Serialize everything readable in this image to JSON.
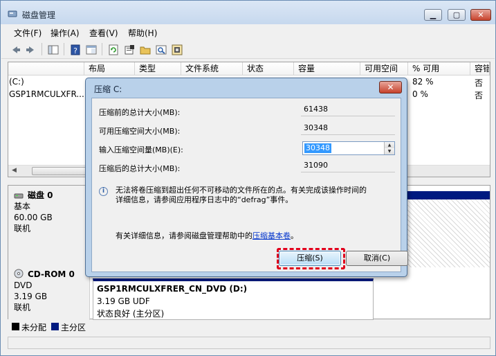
{
  "window": {
    "title": "磁盘管理",
    "min_glyph": "▁",
    "max_glyph": "▢",
    "close_glyph": "✕"
  },
  "menu": [
    "文件(F)",
    "操作(A)",
    "查看(V)",
    "帮助(H)"
  ],
  "toolbar_icons": [
    "back-icon",
    "forward-icon",
    "show-hide-tree-icon",
    "help-icon",
    "properties-pane-icon",
    "refresh-icon",
    "properties-icon",
    "open-icon",
    "explore-icon",
    "rescan-icon"
  ],
  "volume_list": {
    "columns": [
      "",
      "布局",
      "类型",
      "文件系统",
      "状态",
      "容量",
      "可用空间",
      "% 可用",
      "容错"
    ],
    "rows": [
      {
        "volume": "(C:)",
        "pct_free": "82 %",
        "fault_tolerance": "否"
      },
      {
        "volume": "GSP1RMCULXFR...",
        "pct_free": "0 %",
        "fault_tolerance": "否"
      }
    ]
  },
  "disks": [
    {
      "name": "磁盘 0",
      "type": "基本",
      "size": "60.00 GB",
      "status": "联机"
    },
    {
      "name": "CD-ROM 0",
      "type": "DVD",
      "size": "3.19 GB",
      "status": "联机"
    }
  ],
  "cd_partition": {
    "name": "GSP1RMCULXFRER_CN_DVD  (D:)",
    "size_fs": "3.19 GB UDF",
    "status": "状态良好 (主分区)"
  },
  "legend": [
    {
      "label": "未分配",
      "color": "#000000"
    },
    {
      "label": "主分区",
      "color": "#001a80"
    }
  ],
  "dialog": {
    "title": "压缩 C:",
    "close_glyph": "✕",
    "rows": [
      {
        "label": "压缩前的总计大小(MB):",
        "value": "61438"
      },
      {
        "label": "可用压缩空间大小(MB):",
        "value": "30348"
      },
      {
        "label": "输入压缩空间量(MB)(E):",
        "value": "30348"
      },
      {
        "label": "压缩后的总计大小(MB):",
        "value": "31090"
      }
    ],
    "info_line1": "无法将卷压缩到超出任何不可移动的文件所在的点。有关完成该操作时间的",
    "info_line2": "详细信息，请参阅应用程序日志中的“defrag”事件。",
    "more_info_prefix": "有关详细信息，请参阅磁盘管理帮助中的",
    "more_info_link": "压缩基本卷",
    "more_info_suffix": "。",
    "shrink_button": "压缩(S)",
    "cancel_button": "取消(C)"
  }
}
